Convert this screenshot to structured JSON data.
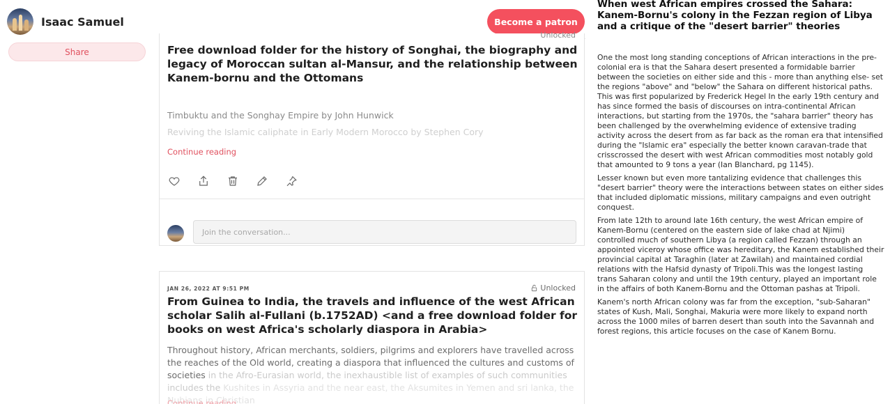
{
  "creator": {
    "name": "Isaac Samuel"
  },
  "share_label": "Share",
  "patron_button": "Become a patron",
  "post1": {
    "unlocked_label": "Unlocked",
    "title": "Free download folder for the history of Songhai, the biography and legacy of Moroccan sultan al-Mansur, and the relationship between Kanem-bornu and the Ottomans",
    "links": [
      "Timbuktu and the Songhay Empire by John Hunwick",
      "Reviving the Islamic caliphate in Early Modern Morocco by Stephen Cory"
    ],
    "continue_label": "Continue reading",
    "comment_placeholder": "Join the conversation..."
  },
  "post2": {
    "date": "JAN 26, 2022 AT 9:51 PM",
    "unlocked_label": "Unlocked",
    "title": "From Guinea to India, the travels and influence of the west African scholar Salih al-Fullani (b.1752AD) <and a free download folder for books on west Africa's scholarly diaspora in Arabia>",
    "excerpt_1": "Throughout history, African merchants, soldiers, pilgrims and explorers have travelled across the reaches of the Old world, creating a diaspora that influenced the cultures and customs of societies",
    "excerpt_2": "in the Afro-Eurasian world, the inexhaustible list of examples of such communities includes the",
    "excerpt_3": "Kushites in Assyria and the near east, the Aksumites in Yemen and sri lanka, the Nubians in Christian",
    "continue_label": "Continue reading"
  },
  "article": {
    "title": "When west African empires crossed the Sahara: Kanem-Bornu's colony in the Fezzan region of Libya and a critique of the \"desert barrier\" theories",
    "paragraphs": [
      "One the most long standing conceptions of African interactions in the pre-colonial era is that the Sahara desert presented a formidable barrier between the societies on either side and this - more than anything else- set the regions \"above\" and \"below\" the Sahara on different historical paths. This was first popularized by Frederick Hegel In the early 19th century and has since formed the basis of discourses on intra-continental African interactions, but starting from the 1970s, the \"sahara barrier\" theory has been challenged by the overwhelming evidence of extensive trading activity across the desert from as far back as the roman era that intensified during the \"Islamic era\" especially the better known caravan-trade that crisscrossed the desert with west African commodities most notably gold that amounted to 9 tons a year (Ian Blanchard, pg 1145).",
      "Lesser known but even more tantalizing evidence that challenges this \"desert barrier\" theory were the interactions between states on either sides that included diplomatic missions, military campaigns and even outright conquest.",
      "From late 12th to around late 16th century, the west African empire of Kanem-Bornu (centered on the eastern side of lake chad at Njimi) controlled much of southern Libya (a region called Fezzan) through an appointed viceroy whose office was hereditary, the Kanem established their provincial capital at Taraghin (later at Zawilah) and maintained cordial relations with the Hafsid dynasty of Tripoli.This was the longest lasting trans Saharan colony and until the 19th century, played an important role in the affairs of both Kanem-Bornu and the Ottoman pashas at Tripoli.",
      "Kanem's north African colony was far from the exception, \"sub-Saharan\" states of Kush, Mali, Songhai, Makuria were more likely to expand north across the 1000 miles of barren desert than south into the Savannah and forest regions, this article focuses on the case of Kanem Bornu."
    ]
  }
}
